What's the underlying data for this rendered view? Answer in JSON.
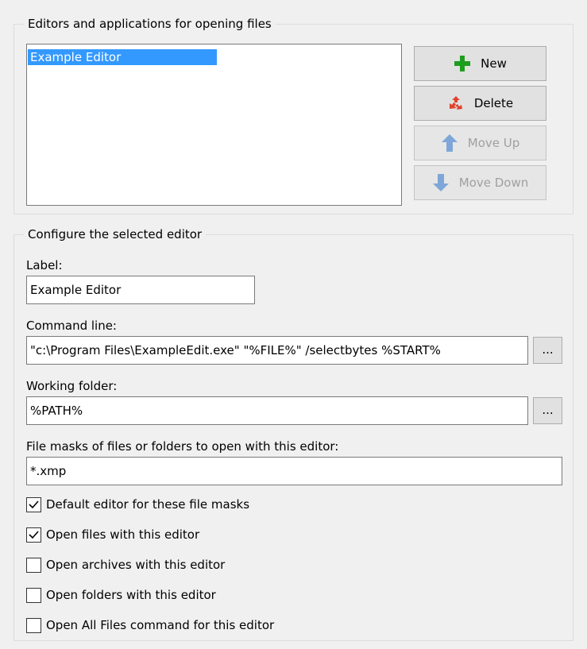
{
  "editors_group": {
    "title": "Editors and applications for opening files",
    "items": [
      "Example Editor"
    ],
    "buttons": {
      "new": "New",
      "delete": "Delete",
      "move_up": "Move Up",
      "move_down": "Move Down"
    }
  },
  "config_group": {
    "title": "Configure the selected editor",
    "label_label": "Label:",
    "label_value": "Example Editor",
    "command_label": "Command line:",
    "command_value": "\"c:\\Program Files\\ExampleEdit.exe\" \"%FILE%\" /selectbytes %START%",
    "working_label": "Working folder:",
    "working_value": "%PATH%",
    "masks_label": "File masks of files or folders to open with this editor:",
    "masks_value": "*.xmp",
    "browse_label": "...",
    "checkboxes": [
      {
        "label": "Default editor for these file masks",
        "checked": true
      },
      {
        "label": "Open files with this editor",
        "checked": true
      },
      {
        "label": "Open archives with this editor",
        "checked": false
      },
      {
        "label": "Open folders with this editor",
        "checked": false
      },
      {
        "label": "Open All Files command for this editor",
        "checked": false
      }
    ]
  },
  "colors": {
    "selection": "#3399ff",
    "new_icon": "#1e9e1e",
    "delete_icon": "#e0432c",
    "arrow_disabled": "#7fa6d8"
  }
}
